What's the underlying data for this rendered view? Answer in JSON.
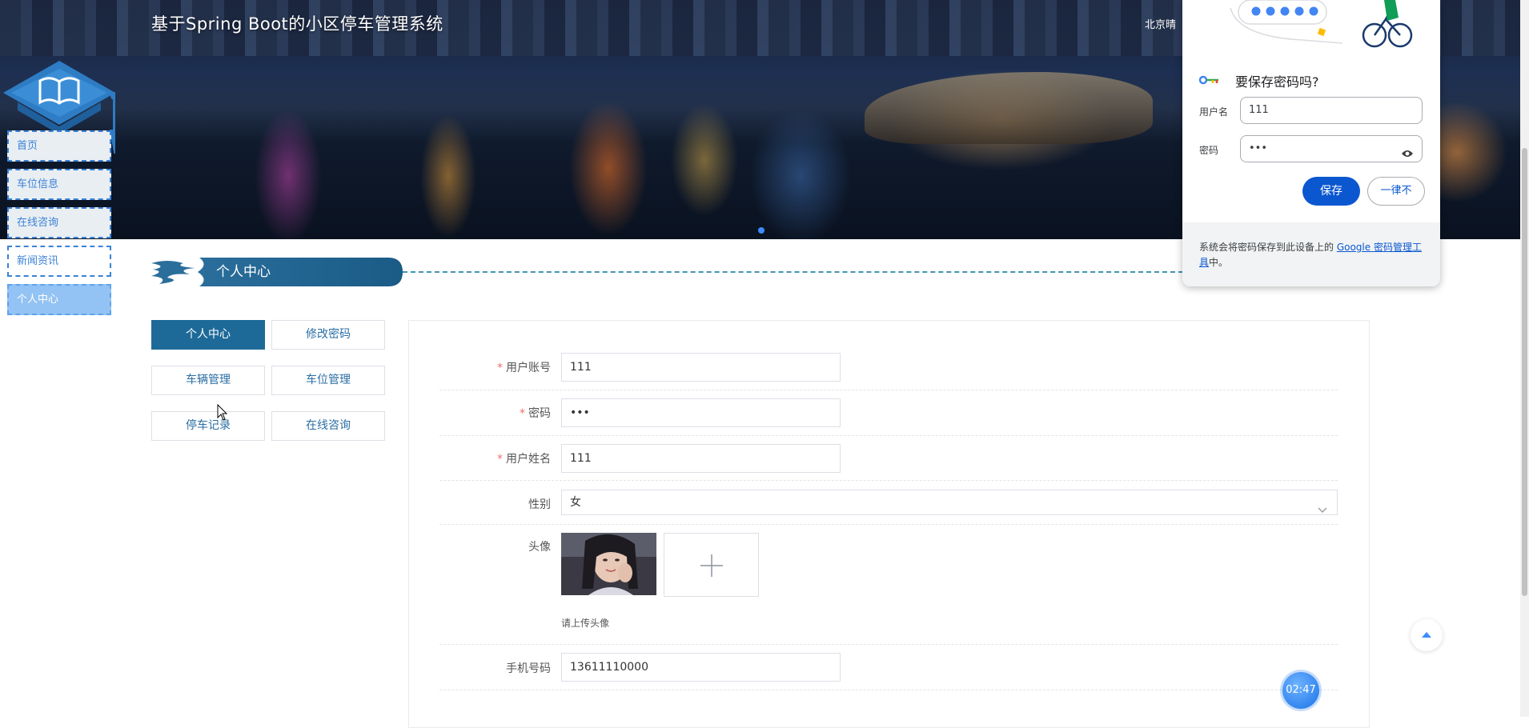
{
  "header": {
    "site_title": "基于Spring Boot的小区停车管理系统",
    "weather_text": "北京晴"
  },
  "nav": {
    "items": [
      "首页",
      "车位信息",
      "在线咨询",
      "新闻资讯",
      "个人中心"
    ],
    "active_index": 4
  },
  "section": {
    "title": "个人中心"
  },
  "side_menu": {
    "items": [
      "个人中心",
      "修改密码",
      "车辆管理",
      "车位管理",
      "停车记录",
      "在线咨询"
    ],
    "active_index": 0
  },
  "form": {
    "account": {
      "label": "用户账号",
      "required": true,
      "value": "111"
    },
    "password": {
      "label": "密码",
      "required": true,
      "value": "•••"
    },
    "name": {
      "label": "用户姓名",
      "required": true,
      "value": "111"
    },
    "gender": {
      "label": "性别",
      "value": "女"
    },
    "avatar": {
      "label": "头像",
      "hint": "请上传头像"
    },
    "phone": {
      "label": "手机号码",
      "value": "13611110000"
    }
  },
  "timer": {
    "text": "02:47"
  },
  "password_popup": {
    "title": "要保存密码吗?",
    "username_label": "用户名",
    "username_value": "111",
    "password_label": "密码",
    "password_value": "•••",
    "save_label": "保存",
    "never_label": "一律不",
    "footer_text": "系统会将密码保存到此设备上的 ",
    "footer_link": "Google 密码管理工具",
    "footer_suffix": "中。"
  },
  "colors": {
    "primary": "#1d6a99",
    "nav_border": "#3b82d6",
    "nav_active": "#93c3f4",
    "google_blue": "#0b57d0",
    "required": "#f56c6c"
  }
}
